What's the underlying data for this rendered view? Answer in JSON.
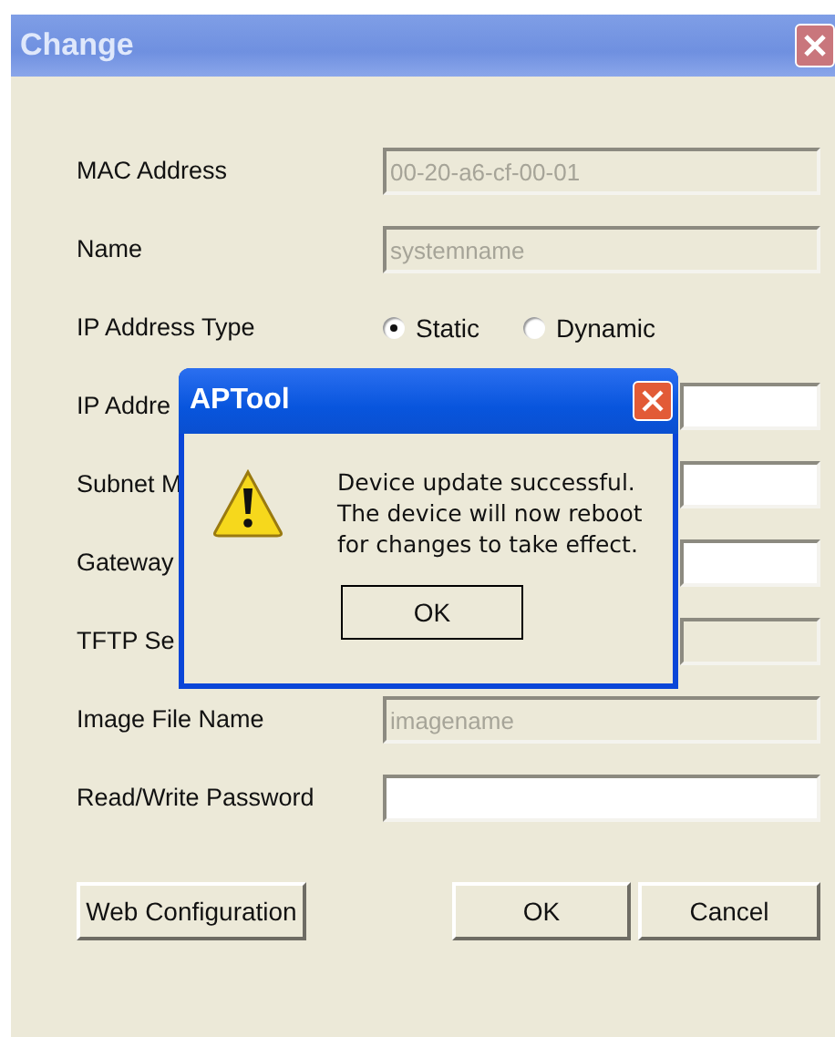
{
  "window": {
    "title": "Change"
  },
  "rows": [
    {
      "label": "MAC Address",
      "kind": "text",
      "value": "00-20-a6-cf-00-01",
      "disabled": true
    },
    {
      "label": "Name",
      "kind": "text",
      "value": "systemname",
      "disabled": true
    },
    {
      "label": "IP Address Type",
      "kind": "radio",
      "options": [
        {
          "label": "Static",
          "selected": true
        },
        {
          "label": "Dynamic",
          "selected": false
        }
      ]
    },
    {
      "label": "IP Addre",
      "kind": "text",
      "disabled": false
    },
    {
      "label": "Subnet M",
      "kind": "text",
      "disabled": false
    },
    {
      "label": "Gateway",
      "kind": "text",
      "disabled": false
    },
    {
      "label": "TFTP Se",
      "kind": "text",
      "disabled": true
    },
    {
      "label": "Image File Name",
      "kind": "text",
      "value": "imagename",
      "disabled": true
    },
    {
      "label": "Read/Write Password",
      "kind": "text",
      "disabled": false
    }
  ],
  "buttons": {
    "left": "Web Configuration",
    "ok": "OK",
    "cancel": "Cancel"
  },
  "dialog": {
    "title": "APTool",
    "message": "Device update successful.\nThe device will now reboot\nfor changes to take effect.",
    "button": "OK"
  }
}
